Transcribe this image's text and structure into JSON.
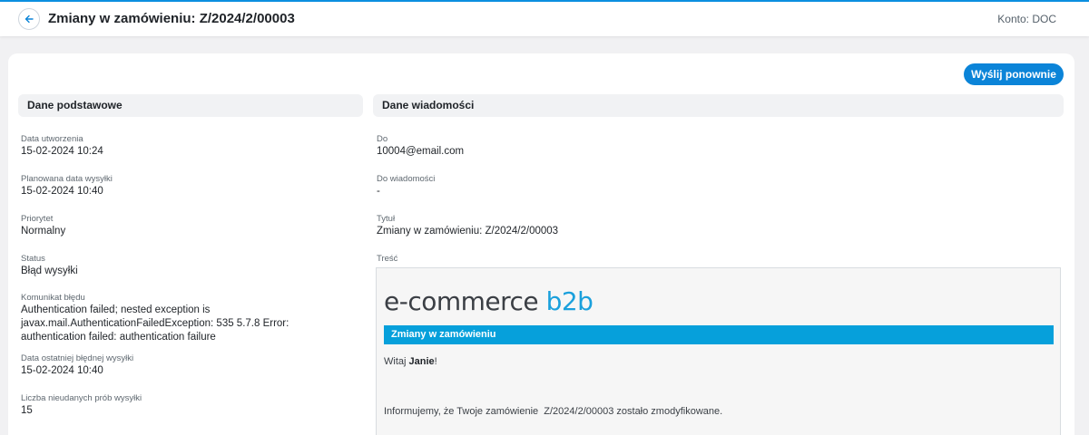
{
  "header": {
    "title": "Zmiany w zamówieniu: Z/2024/2/00003",
    "account_label": "Konto: DOC",
    "back_icon": "arrow-left-icon"
  },
  "actions": {
    "resend_label": "Wyślij ponownie"
  },
  "basic": {
    "section_title": "Dane podstawowe",
    "created_label": "Data utworzenia",
    "created_value": "15-02-2024 10:24",
    "planned_label": "Planowana data wysyłki",
    "planned_value": "15-02-2024 10:40",
    "priority_label": "Priorytet",
    "priority_value": "Normalny",
    "status_label": "Status",
    "status_value": "Błąd wysyłki",
    "error_label": "Komunikat błędu",
    "error_value": "Authentication failed; nested exception is javax.mail.AuthenticationFailedException: 535 5.7.8 Error: authentication failed: authentication failure",
    "last_error_label": "Data ostatniej błędnej wysyłki",
    "last_error_value": "15-02-2024 10:40",
    "failed_count_label": "Liczba nieudanych prób wysyłki",
    "failed_count_value": "15"
  },
  "message": {
    "section_title": "Dane wiadomości",
    "to_label": "Do",
    "to_value": "10004@email.com",
    "cc_label": "Do wiadomości",
    "cc_value": "-",
    "subject_label": "Tytuł",
    "subject_value": "Zmiany w zamówieniu: Z/2024/2/00003",
    "content_label": "Treść"
  },
  "email_preview": {
    "logo_main": "e-commerce ",
    "logo_accent": "b2b",
    "header": "Zmiany w zamówieniu",
    "greeting_prefix": "Witaj ",
    "greeting_name": "Janie",
    "greeting_suffix": "!",
    "body": "Informujemy, że Twoje zamówienie  Z/2024/2/00003 zostało zmodyfikowane.",
    "accent_color": "#06a0db"
  }
}
